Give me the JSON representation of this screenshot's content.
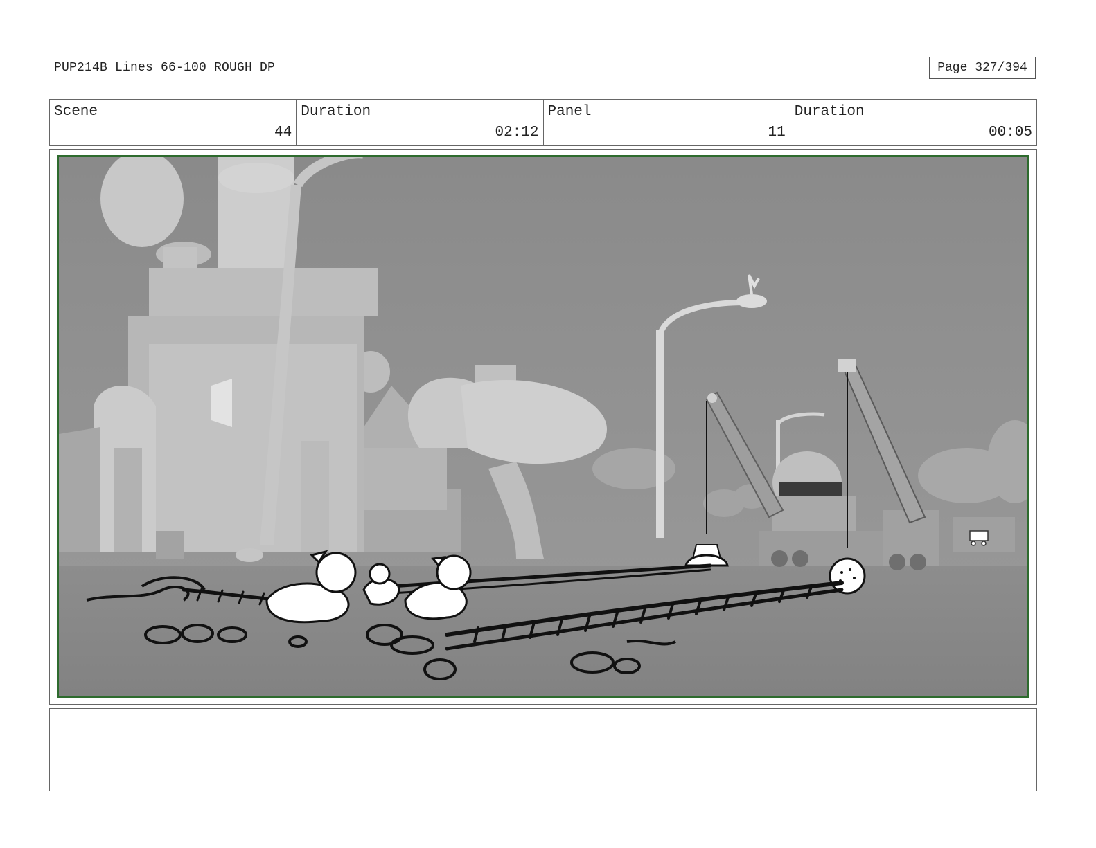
{
  "header": {
    "title": "PUP214B Lines 66-100 ROUGH DP",
    "page": "Page 327/394"
  },
  "info": [
    {
      "label": "Scene",
      "value": "44"
    },
    {
      "label": "Duration",
      "value": "02:12"
    },
    {
      "label": "Panel",
      "value": "11"
    },
    {
      "label": "Duration",
      "value": "00:05"
    }
  ],
  "panel": {
    "image_name": "storyboard-panel-sketch",
    "frame_color": "#2e6b2e"
  },
  "notes": {
    "text": ""
  }
}
